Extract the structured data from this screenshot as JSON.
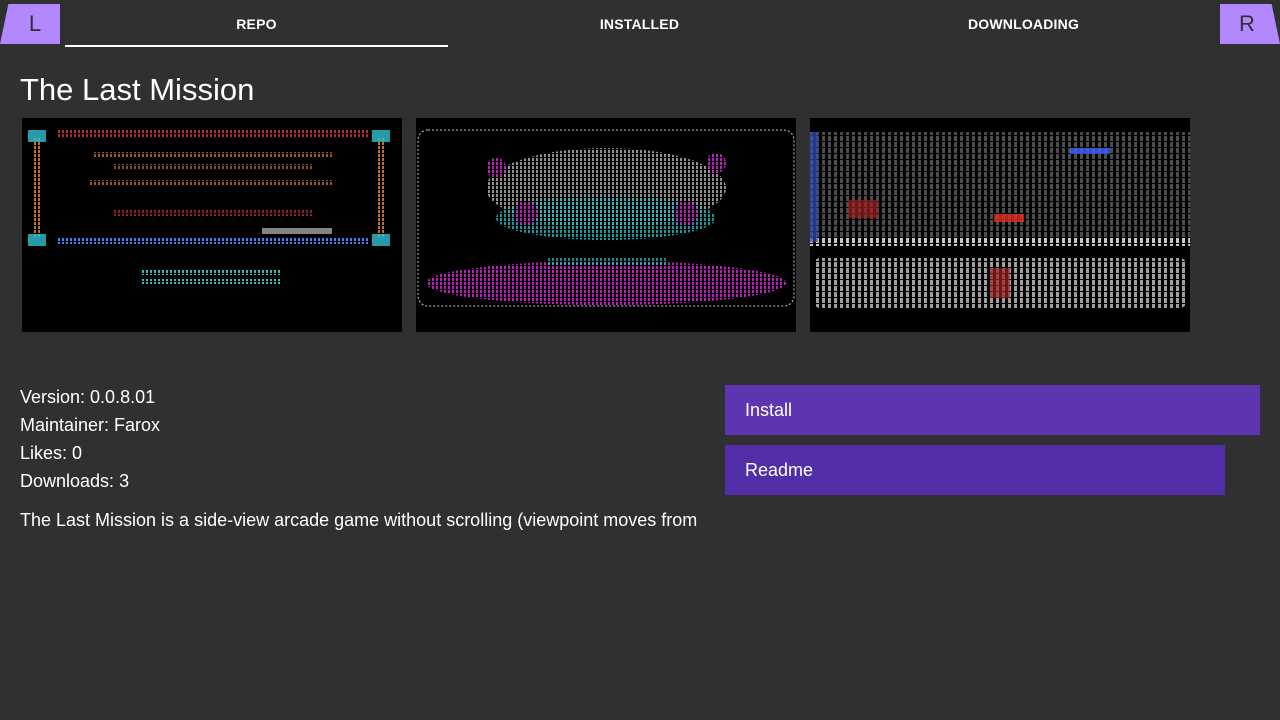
{
  "topbar": {
    "left_button": "L",
    "right_button": "R",
    "tabs": [
      {
        "label": "REPO",
        "active": true
      },
      {
        "label": "INSTALLED",
        "active": false
      },
      {
        "label": "DOWNLOADING",
        "active": false
      }
    ]
  },
  "app": {
    "title": "The Last Mission",
    "screenshots": [
      "title-screen",
      "ship-screen",
      "level-screen"
    ],
    "version_label": "Version: ",
    "version": "0.0.8.01",
    "maintainer_label": "Maintainer: ",
    "maintainer": "Farox",
    "likes_label": "Likes: ",
    "likes": "0",
    "downloads_label": "Downloads: ",
    "downloads": "3",
    "description": "The Last Mission is a side-view arcade game without scrolling (viewpoint moves from"
  },
  "actions": {
    "install_label": "Install",
    "readme_label": "Readme"
  },
  "colors": {
    "background": "#303030",
    "accent": "#b388ff",
    "install_button": "#5e35b1",
    "readme_button": "#512da8"
  }
}
